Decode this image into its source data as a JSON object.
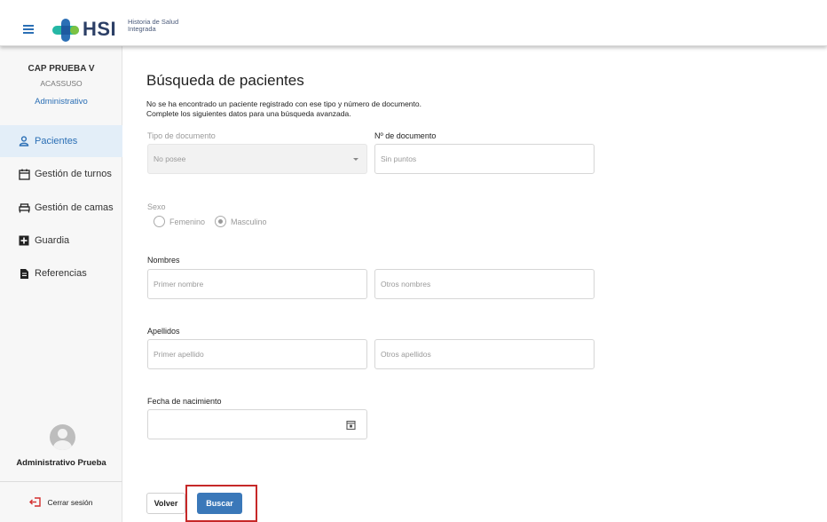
{
  "header": {
    "logo_text": "HSI",
    "logo_subtitle_line1": "Historia de Salud",
    "logo_subtitle_line2": "Integrada",
    "brand_colors": {
      "cross_blue": "#2b6fb5",
      "cross_teal": "#25b7a5",
      "cross_green": "#7cc242",
      "text": "#2c3f66"
    }
  },
  "sidebar": {
    "institution": "CAP PRUEBA V",
    "location": "ACASSUSO",
    "role": "Administrativo",
    "items": [
      {
        "label": "Pacientes",
        "icon": "person-icon",
        "active": true
      },
      {
        "label": "Gestión de turnos",
        "icon": "calendar-icon",
        "active": false
      },
      {
        "label": "Gestión de camas",
        "icon": "bed-icon",
        "active": false
      },
      {
        "label": "Guardia",
        "icon": "plus-box-icon",
        "active": false
      },
      {
        "label": "Referencias",
        "icon": "document-icon",
        "active": false
      }
    ],
    "user_name": "Administrativo Prueba",
    "logout_label": "Cerrar sesión"
  },
  "main": {
    "title": "Búsqueda de pacientes",
    "message_line1": "No se ha encontrado un paciente registrado con ese tipo y número de documento.",
    "message_line2": "Complete los siguientes datos para una búsqueda avanzada.",
    "doc_type_label": "Tipo de documento",
    "doc_type_value": "No posee",
    "doc_number_label": "Nº de documento",
    "doc_number_placeholder": "Sin puntos",
    "sex_label": "Sexo",
    "sex_options": [
      "Femenino",
      "Masculino"
    ],
    "sex_selected": "Masculino",
    "names_label": "Nombres",
    "first_name_placeholder": "Primer nombre",
    "other_names_placeholder": "Otros nombres",
    "surnames_label": "Apellidos",
    "first_surname_placeholder": "Primer apellido",
    "other_surnames_placeholder": "Otros apellidos",
    "birthdate_label": "Fecha de nacimiento",
    "back_button": "Volver",
    "search_button": "Buscar",
    "accent_color": "#3a78b9"
  }
}
